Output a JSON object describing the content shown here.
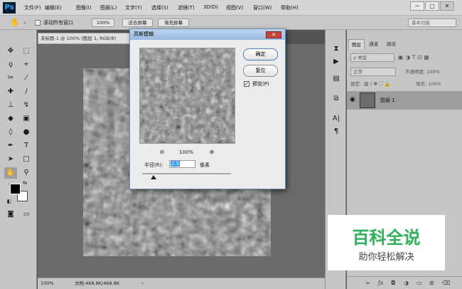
{
  "app": {
    "logo": "Ps",
    "menu": [
      "文件(F)",
      "编辑(E)",
      "图像(I)",
      "图层(L)",
      "文字(Y)",
      "选择(S)",
      "滤镜(T)",
      "3D(D)",
      "视图(V)",
      "窗口(W)",
      "帮助(H)"
    ],
    "window_controls": [
      "─",
      "□",
      "✕"
    ]
  },
  "options_bar": {
    "scroll_all_label": "滚动所有窗口",
    "zoom_value": "100%",
    "fit_screen_label": "适合屏幕",
    "fill_screen_label": "填充屏幕",
    "workspace_label": "基本功能"
  },
  "document": {
    "tab_title": "未标题-1 @ 100% (图层 1, RGB/8)",
    "status_zoom": "100%",
    "status_doc": "文档:468.8K/468.8K"
  },
  "layers_panel": {
    "tabs": [
      "图层",
      "通道",
      "路径"
    ],
    "kind_label": "ρ 类型",
    "blend_mode": "正常",
    "opacity_label": "不透明度: 100%",
    "lock_label": "锁定:",
    "fill_label": "填充: 100%",
    "layer_name": "图层 1",
    "footer_icons": [
      "link-icon",
      "fx-icon",
      "mask-icon",
      "adjustment-icon",
      "folder-icon",
      "new-layer-icon",
      "trash-icon"
    ]
  },
  "dialog": {
    "title": "高斯模糊",
    "ok_label": "确定",
    "reset_label": "复位",
    "preview_label": "预览(P)",
    "preview_checked": true,
    "zoom_level": "100%",
    "radius_label": "半径(R):",
    "radius_value": "2.5",
    "radius_unit": "像素"
  },
  "watermark": {
    "title": "百科全说",
    "subtitle": "助你轻松解决",
    "title_color": "#2fb15a"
  }
}
